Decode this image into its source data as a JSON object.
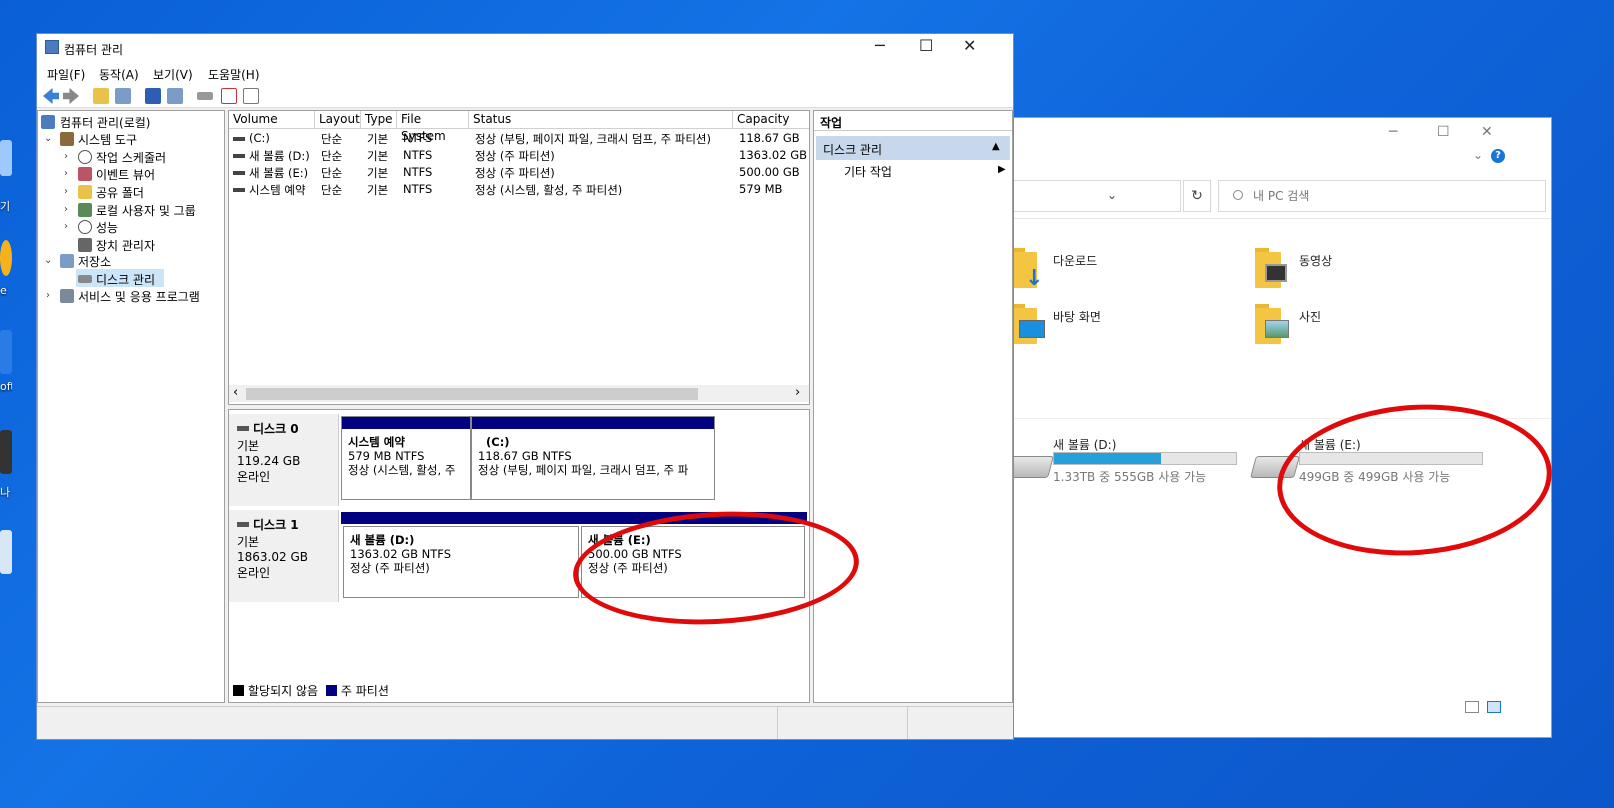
{
  "colors": {
    "accent": "#000080",
    "selection": "#c7d7ec",
    "annotation": "#e00a0a",
    "drive_bar": "#26a0da"
  },
  "desktop": {
    "fragments": [
      "기",
      "e",
      "oft",
      "나"
    ]
  },
  "mmc": {
    "title": "컴퓨터 관리",
    "window_controls": {
      "minimize": "─",
      "maximize": "☐",
      "close": "✕"
    },
    "menu": [
      "파일(F)",
      "동작(A)",
      "보기(V)",
      "도움말(H)"
    ],
    "tree": {
      "root": "컴퓨터 관리(로컬)",
      "system_tools": "시스템 도구",
      "task_scheduler": "작업 스케줄러",
      "event_viewer": "이벤트 뷰어",
      "shared_folders": "공유 폴더",
      "local_users": "로컬 사용자 및 그룹",
      "performance": "성능",
      "device_manager": "장치 관리자",
      "storage": "저장소",
      "disk_management": "디스크 관리",
      "services": "서비스 및 응용 프로그램"
    },
    "columns": [
      "Volume",
      "Layout",
      "Type",
      "File System",
      "Status",
      "Capacity"
    ],
    "rows": [
      [
        "(C:)",
        "단순",
        "기본",
        "NTFS",
        "정상 (부팅, 페이지 파일, 크래시 덤프, 주 파티션)",
        "118.67 GB"
      ],
      [
        "새 볼륨 (D:)",
        "단순",
        "기본",
        "NTFS",
        "정상 (주 파티션)",
        "1363.02 GB"
      ],
      [
        "새 볼륨 (E:)",
        "단순",
        "기본",
        "NTFS",
        "정상 (주 파티션)",
        "500.00 GB"
      ],
      [
        "시스템 예약",
        "단순",
        "기본",
        "NTFS",
        "정상 (시스템, 활성, 주 파티션)",
        "579 MB"
      ]
    ],
    "scroll": {
      "left": "‹",
      "right": "›"
    },
    "disks": [
      {
        "name": "디스크 0",
        "type": "기본",
        "size": "119.24 GB",
        "state": "온라인",
        "partitions": [
          {
            "title": "시스템 예약",
            "size": "579 MB NTFS",
            "status": "정상 (시스템, 활성, 주"
          },
          {
            "title": "(C:)",
            "size": "118.67 GB NTFS",
            "status": "정상 (부팅, 페이지 파일, 크래시 덤프, 주 파"
          }
        ]
      },
      {
        "name": "디스크 1",
        "type": "기본",
        "size": "1863.02 GB",
        "state": "온라인",
        "partitions": [
          {
            "title": "새 볼륨  (D:)",
            "size": "1363.02 GB NTFS",
            "status": "정상 (주 파티션)"
          },
          {
            "title": "새 볼륨  (E:)",
            "size": "500.00 GB NTFS",
            "status": "정상 (주 파티션)"
          }
        ]
      }
    ],
    "legend": {
      "unallocated": "할당되지 않음",
      "primary": "주 파티션"
    },
    "actions": {
      "header": "작업",
      "selected": "디스크 관리",
      "selected_arrow": "▲",
      "more": "기타 작업",
      "more_arrow": "▶"
    }
  },
  "explorer": {
    "window_controls": {
      "minimize": "─",
      "maximize": "☐",
      "close": "✕"
    },
    "help": "?",
    "expand": "⌄",
    "address_dropdown": "⌄",
    "refresh": "↻",
    "search_placeholder": "내 PC 검색",
    "folders": [
      "다운로드",
      "동영상",
      "바탕 화면",
      "사진"
    ],
    "drives": [
      {
        "name": "새 볼륨 (D:)",
        "free": "1.33TB 중 555GB 사용 가능",
        "used_fraction": 0.59
      },
      {
        "name": "새 볼륨 (E:)",
        "free": "499GB 중 499GB 사용 가능",
        "used_fraction": 0.0
      }
    ]
  }
}
